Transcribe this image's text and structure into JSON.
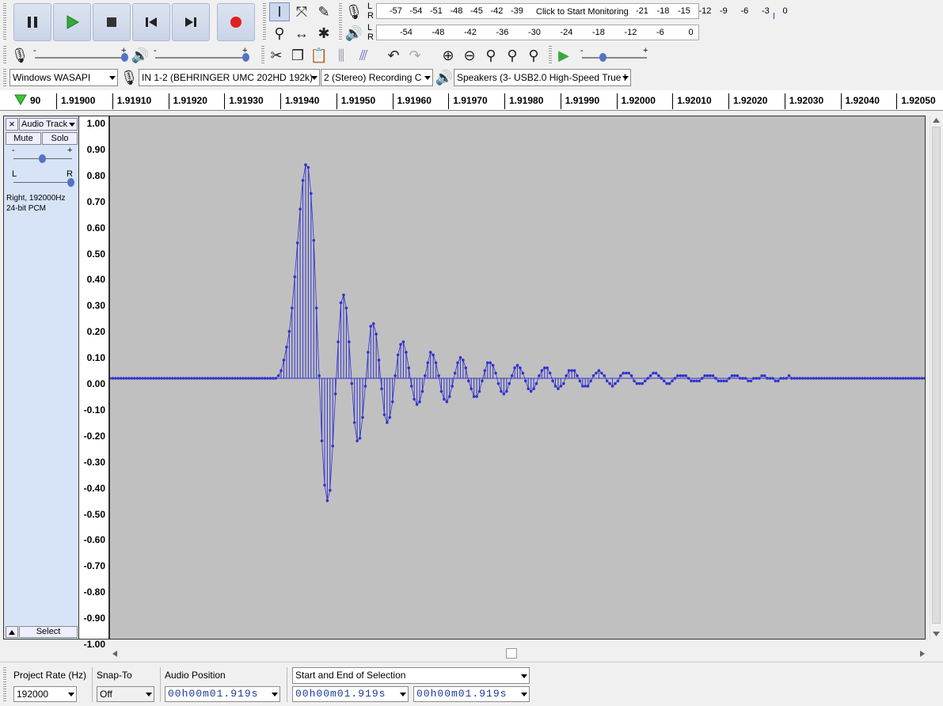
{
  "transport": {
    "pause": "pause",
    "play": "play",
    "stop": "stop",
    "skip_start": "skip-to-start",
    "skip_end": "skip-to-end",
    "record": "record"
  },
  "meters": {
    "record": {
      "l": "L",
      "r": "R",
      "ticks_left": [
        "-57",
        "-54",
        "-51",
        "-48",
        "-45",
        "-42",
        "-39"
      ],
      "prompt": "Click to Start Monitoring",
      "ticks_right": [
        "-21",
        "-18",
        "-15",
        "-12",
        "-9",
        "-6",
        "-3",
        "0"
      ]
    },
    "playback": {
      "l": "L",
      "r": "R",
      "ticks": [
        "-54",
        "-48",
        "-42",
        "-36",
        "-30",
        "-24",
        "-18",
        "-12",
        "-6",
        "0"
      ]
    }
  },
  "mixer": {
    "minus": "-",
    "plus": "+"
  },
  "device_toolbar": {
    "host": "Windows WASAPI",
    "input": "IN 1-2 (BEHRINGER UMC 202HD 192k)",
    "channels": "2 (Stereo) Recording C",
    "output": "Speakers (3- USB2.0 High-Speed True I"
  },
  "ruler": {
    "labels": [
      "90",
      "1.91900",
      "1.91910",
      "1.91920",
      "1.91930",
      "1.91940",
      "1.91950",
      "1.91960",
      "1.91970",
      "1.91980",
      "1.91990",
      "1.92000",
      "1.92010",
      "1.92020",
      "1.92030",
      "1.92040",
      "1.92050"
    ]
  },
  "track": {
    "close": "×",
    "name": "Audio Track",
    "mute": "Mute",
    "solo": "Solo",
    "gain_minus": "-",
    "gain_plus": "+",
    "pan_l": "L",
    "pan_r": "R",
    "info1": "Right, 192000Hz",
    "info2": "24-bit PCM",
    "select": "Select"
  },
  "vruler": [
    "1.00",
    "0.90",
    "0.80",
    "0.70",
    "0.60",
    "0.50",
    "0.40",
    "0.30",
    "0.20",
    "0.10",
    "0.00",
    "-0.10",
    "-0.20",
    "-0.30",
    "-0.40",
    "-0.50",
    "-0.60",
    "-0.70",
    "-0.80",
    "-0.90",
    "-1.00"
  ],
  "waveform": {
    "color": "#3333cc",
    "samples": [
      0,
      0,
      0,
      0,
      0,
      0,
      0,
      0,
      0,
      0,
      0,
      0,
      0,
      0,
      0,
      0,
      0,
      0,
      0,
      0,
      0,
      0,
      0,
      0,
      0,
      0,
      0,
      0,
      0,
      0,
      0,
      0,
      0,
      0,
      0,
      0,
      0,
      0,
      0,
      0,
      0,
      0,
      0,
      0,
      0,
      0,
      0,
      0,
      0,
      0,
      0,
      0,
      0,
      0,
      0,
      0,
      0,
      0,
      0,
      0,
      0,
      0,
      0.01,
      0.03,
      0.07,
      0.12,
      0.18,
      0.27,
      0.39,
      0.52,
      0.65,
      0.76,
      0.82,
      0.81,
      0.71,
      0.53,
      0.27,
      0.01,
      -0.24,
      -0.41,
      -0.47,
      -0.43,
      -0.26,
      -0.06,
      0.14,
      0.29,
      0.32,
      0.27,
      0.14,
      -0.02,
      -0.17,
      -0.24,
      -0.23,
      -0.15,
      -0.03,
      0.1,
      0.2,
      0.21,
      0.17,
      0.07,
      -0.04,
      -0.14,
      -0.17,
      -0.15,
      -0.09,
      0.01,
      0.09,
      0.13,
      0.14,
      0.1,
      0.04,
      -0.03,
      -0.08,
      -0.1,
      -0.09,
      -0.05,
      0.01,
      0.06,
      0.1,
      0.09,
      0.06,
      0.01,
      -0.05,
      -0.08,
      -0.09,
      -0.07,
      -0.03,
      0.02,
      0.06,
      0.08,
      0.07,
      0.04,
      -0.01,
      -0.04,
      -0.07,
      -0.07,
      -0.05,
      -0.01,
      0.03,
      0.06,
      0.06,
      0.05,
      0.02,
      -0.02,
      -0.05,
      -0.06,
      -0.05,
      -0.02,
      0.01,
      0.04,
      0.05,
      0.04,
      0.02,
      -0.01,
      -0.04,
      -0.05,
      -0.04,
      -0.02,
      0.01,
      0.03,
      0.04,
      0.04,
      0.02,
      -0.01,
      -0.03,
      -0.04,
      -0.03,
      -0.02,
      0.01,
      0.03,
      0.03,
      0.03,
      0.01,
      -0.01,
      -0.03,
      -0.03,
      -0.03,
      -0.01,
      0.01,
      0.02,
      0.03,
      0.02,
      0.01,
      -0.01,
      -0.02,
      -0.03,
      -0.02,
      -0.01,
      0.01,
      0.02,
      0.02,
      0.02,
      0.01,
      -0.01,
      -0.02,
      -0.02,
      -0.02,
      -0.01,
      0,
      0.01,
      0.02,
      0.02,
      0.01,
      0,
      -0.01,
      -0.02,
      -0.02,
      -0.01,
      0,
      0.01,
      0.01,
      0.01,
      0.01,
      0,
      -0.01,
      -0.01,
      -0.01,
      -0.01,
      0,
      0.01,
      0.01,
      0.01,
      0.01,
      0,
      -0.01,
      -0.01,
      -0.01,
      -0.01,
      0,
      0.01,
      0.01,
      0.01,
      0,
      0,
      0,
      -0.01,
      -0.01,
      0,
      0,
      0,
      0.01,
      0.01,
      0,
      0,
      0,
      -0.01,
      -0.01,
      0,
      0,
      0,
      0.01,
      0,
      0,
      0,
      0,
      0,
      0,
      0,
      0,
      0,
      0,
      0,
      0,
      0,
      0,
      0,
      0,
      0,
      0,
      0,
      0,
      0,
      0,
      0,
      0,
      0,
      0,
      0,
      0,
      0,
      0,
      0,
      0,
      0,
      0,
      0,
      0,
      0,
      0,
      0,
      0,
      0,
      0,
      0,
      0,
      0,
      0,
      0,
      0,
      0,
      0
    ]
  },
  "statusbar": {
    "rate_label": "Project Rate (Hz)",
    "rate_value": "192000",
    "snap_label": "Snap-To",
    "snap_value": "Off",
    "pos_label": "Audio Position",
    "pos_value": "00h00m01.919s",
    "sel_mode": "Start and End of Selection",
    "sel_start": "00h00m01.919s",
    "sel_end": "00h00m01.919s"
  }
}
